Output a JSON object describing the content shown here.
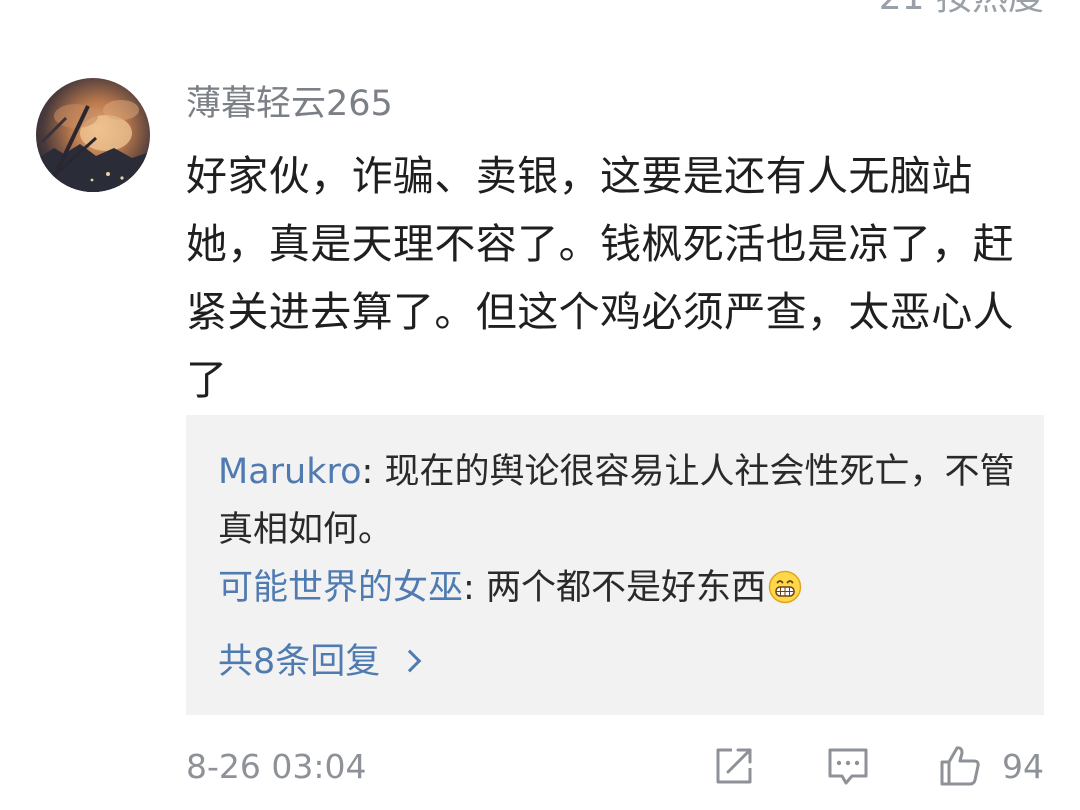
{
  "header": {
    "cut_text": "21 按热度"
  },
  "comment": {
    "username": "薄暮轻云265",
    "text": "好家伙，诈骗、卖银，这要是还有人无脑站她，真是天理不容了。钱枫死活也是凉了，赶紧关进去算了。但这个鸡必须严查，太恶心人了",
    "timestamp": "8-26 03:04",
    "like_count": "94",
    "replies": [
      {
        "author": "Marukro",
        "text": "现在的舆论很容易让人社会性死亡，不管真相如何。"
      },
      {
        "author": "可能世界的女巫",
        "text": "两个都不是好东西",
        "emoji": "grinning-face-emoji"
      }
    ],
    "more_replies_label": "共8条回复"
  },
  "icons": {
    "share": "share-icon",
    "comment": "comment-icon",
    "like": "thumbs-up-icon",
    "more": "chevron-right-icon"
  },
  "colors": {
    "link_blue": "#4f7bb0",
    "reply_bg": "#f2f2f2",
    "meta_gray": "#8e9298",
    "text": "#1f1f1f"
  }
}
